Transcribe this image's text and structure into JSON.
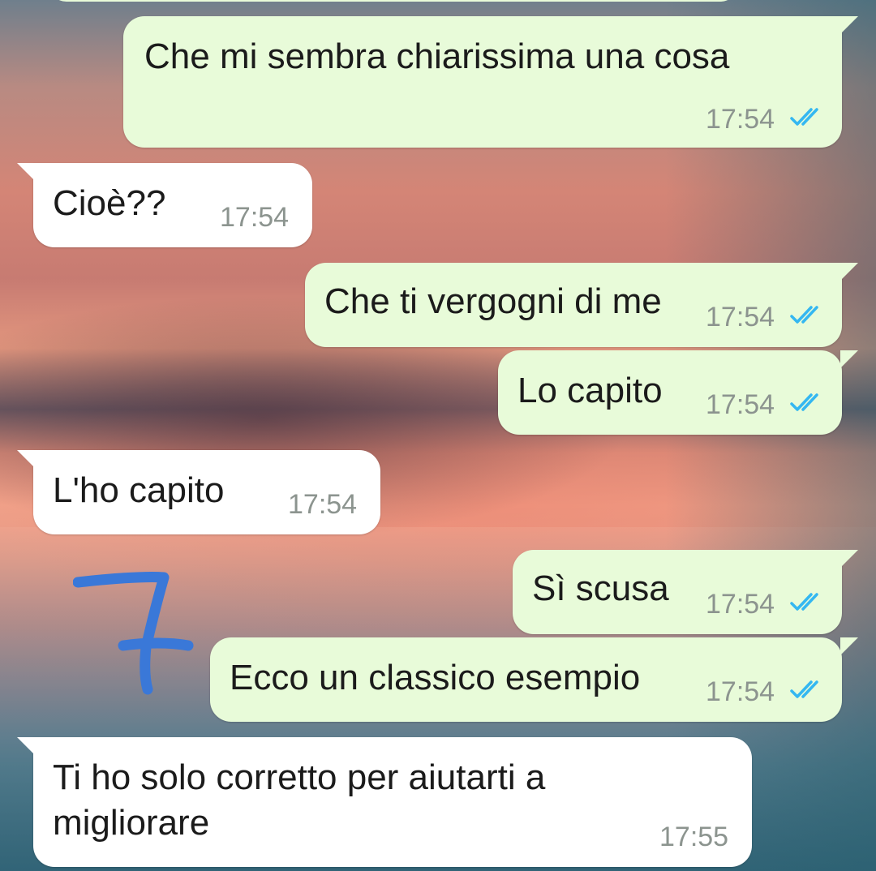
{
  "messages": [
    {
      "id": "m1",
      "direction": "outgoing",
      "text": "Che mi sembra chiarissima una cosa",
      "time": "17:54",
      "status": "read"
    },
    {
      "id": "m2",
      "direction": "incoming",
      "text": "Cioè??",
      "time": "17:54"
    },
    {
      "id": "m3",
      "direction": "outgoing",
      "text": "Che ti vergogni di me",
      "time": "17:54",
      "status": "read"
    },
    {
      "id": "m4",
      "direction": "outgoing",
      "text": "Lo capito",
      "time": "17:54",
      "status": "read"
    },
    {
      "id": "m5",
      "direction": "incoming",
      "text": "L'ho capito",
      "time": "17:54"
    },
    {
      "id": "m6",
      "direction": "outgoing",
      "text": "Sì scusa",
      "time": "17:54",
      "status": "read"
    },
    {
      "id": "m7",
      "direction": "outgoing",
      "text": "Ecco un classico esempio",
      "time": "17:54",
      "status": "read"
    },
    {
      "id": "m8",
      "direction": "incoming",
      "text_line1": "Ti ho solo corretto per aiutarti a",
      "text_line2": "migliorare",
      "time": "17:55"
    }
  ],
  "colors": {
    "outgoing_bubble": "#e8fbd9",
    "incoming_bubble": "#ffffff",
    "read_ticks": "#34b7f1",
    "timestamp": "#8c948f",
    "doodle": "#3a78d8"
  },
  "icons": {
    "read_status": "double-check-icon",
    "annotation": "hand-drawn-seven"
  }
}
